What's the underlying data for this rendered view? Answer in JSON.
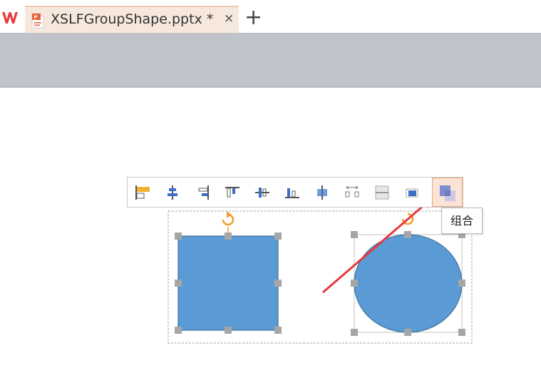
{
  "tab": {
    "title": "XSLFGroupShape.pptx *",
    "close_label": "×"
  },
  "newtab_label": "+",
  "colors": {
    "shape_fill": "#5b9bd5",
    "shape_stroke": "#41719c",
    "accent": "#f0a030",
    "arrow": "#e8383d",
    "tab_bg": "#f6e8dc",
    "toolband": "#c0c3ca"
  },
  "toolbar": {
    "buttons": [
      {
        "name": "align-left-icon"
      },
      {
        "name": "align-center-icon"
      },
      {
        "name": "align-right-icon"
      },
      {
        "name": "align-top-icon"
      },
      {
        "name": "align-middle-icon"
      },
      {
        "name": "align-bottom-icon"
      },
      {
        "name": "distribute-horizontal-icon"
      },
      {
        "name": "distribute-horizontal-spacing-icon"
      },
      {
        "name": "distribute-vertical-icon"
      },
      {
        "name": "fit-to-slide-icon"
      },
      {
        "name": "group-icon"
      }
    ]
  },
  "tooltip": {
    "text": "组合"
  }
}
